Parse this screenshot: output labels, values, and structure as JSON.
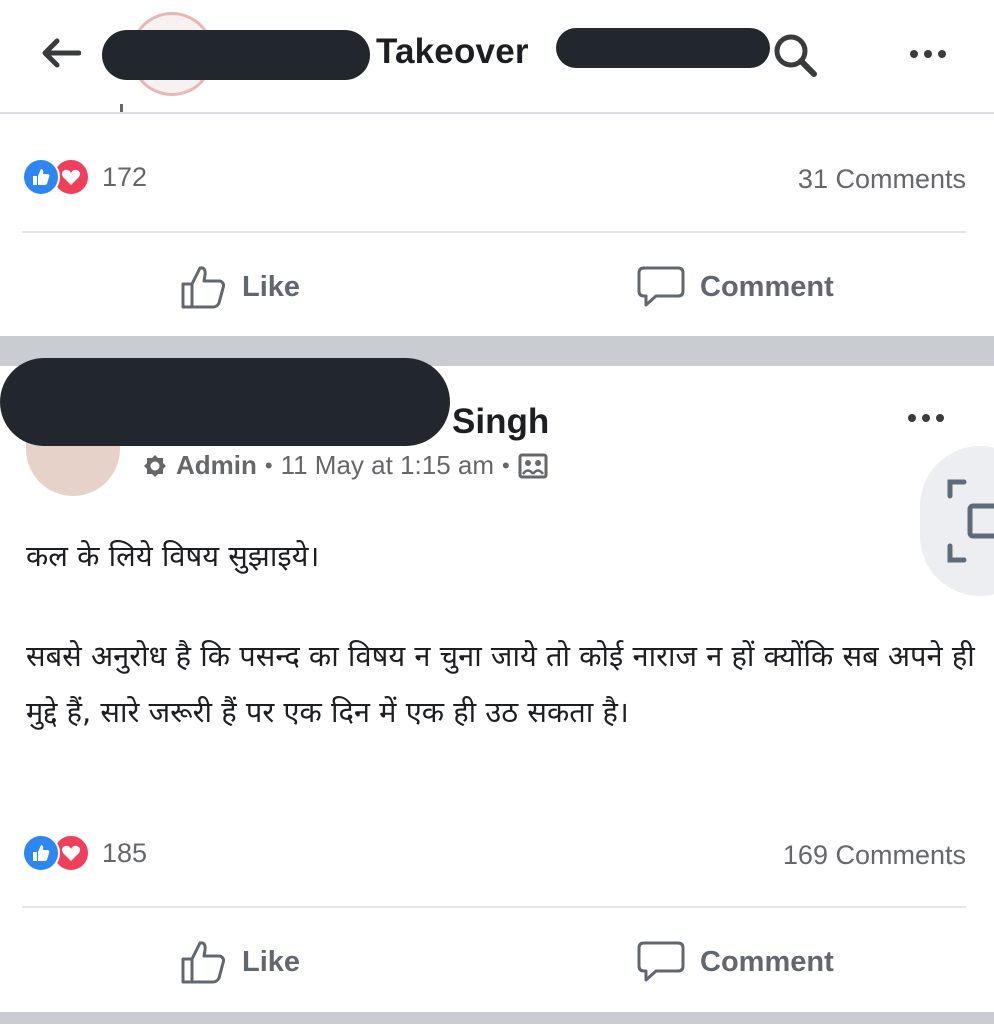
{
  "header": {
    "title": "Takeover"
  },
  "post1": {
    "reaction_count": "172",
    "comment_count": "31 Comments",
    "like_label": "Like",
    "comment_label": "Comment"
  },
  "post2": {
    "author_suffix": "Singh",
    "role": "Admin",
    "timestamp": "11 May at 1:15 am",
    "body_line1": "कल के लिये विषय सुझाइये।",
    "body_para2": "सबसे अनुरोध है कि पसन्द का विषय न चुना जाये तो कोई नाराज न हों क्योंकि सब अपने ही मुद्दे हैं, सारे जरूरी हैं पर एक दिन में एक ही उठ सकता है।",
    "reaction_count": "185",
    "comment_count": "169 Comments",
    "like_label": "Like",
    "comment_label": "Comment"
  },
  "colors": {
    "like": "#2e86f0",
    "love": "#ef3f5b",
    "muted_text": "#65676b",
    "redaction": "#22272d"
  }
}
